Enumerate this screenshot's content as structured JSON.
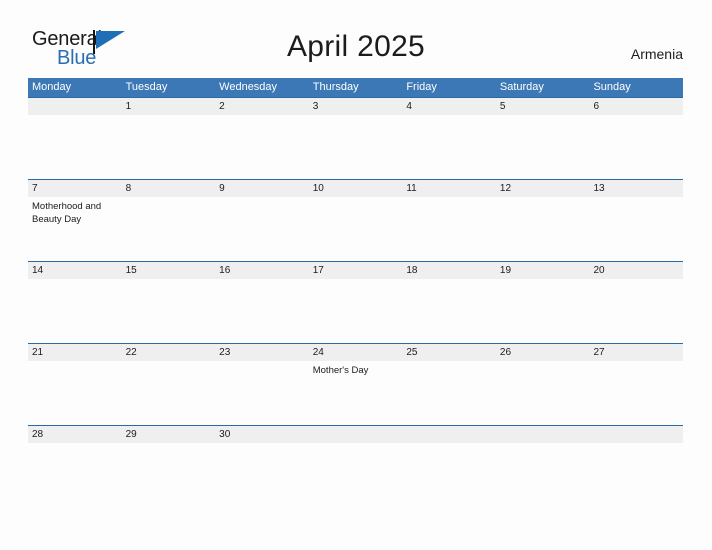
{
  "branding": {
    "logo_text_1": "General",
    "logo_text_2": "Blue",
    "logo_icon": "flag-triangle-icon"
  },
  "header": {
    "title": "April 2025",
    "location": "Armenia"
  },
  "colors": {
    "header_blue": "#3b78b5",
    "divider_blue": "#2a6aa5",
    "band_gray": "#efefef",
    "logo_blue": "#2a6db3",
    "page_background": "#fdfdfd",
    "text": "#1c1c1c"
  },
  "calendar": {
    "month": "April",
    "year": "2025",
    "weekday_headers": [
      "Monday",
      "Tuesday",
      "Wednesday",
      "Thursday",
      "Friday",
      "Saturday",
      "Sunday"
    ],
    "weeks": [
      {
        "days": [
          {
            "num": "",
            "event": ""
          },
          {
            "num": "1",
            "event": ""
          },
          {
            "num": "2",
            "event": ""
          },
          {
            "num": "3",
            "event": ""
          },
          {
            "num": "4",
            "event": ""
          },
          {
            "num": "5",
            "event": ""
          },
          {
            "num": "6",
            "event": ""
          }
        ]
      },
      {
        "days": [
          {
            "num": "7",
            "event": "Motherhood and Beauty Day"
          },
          {
            "num": "8",
            "event": ""
          },
          {
            "num": "9",
            "event": ""
          },
          {
            "num": "10",
            "event": ""
          },
          {
            "num": "11",
            "event": ""
          },
          {
            "num": "12",
            "event": ""
          },
          {
            "num": "13",
            "event": ""
          }
        ]
      },
      {
        "days": [
          {
            "num": "14",
            "event": ""
          },
          {
            "num": "15",
            "event": ""
          },
          {
            "num": "16",
            "event": ""
          },
          {
            "num": "17",
            "event": ""
          },
          {
            "num": "18",
            "event": ""
          },
          {
            "num": "19",
            "event": ""
          },
          {
            "num": "20",
            "event": ""
          }
        ]
      },
      {
        "days": [
          {
            "num": "21",
            "event": ""
          },
          {
            "num": "22",
            "event": ""
          },
          {
            "num": "23",
            "event": ""
          },
          {
            "num": "24",
            "event": "Mother's Day"
          },
          {
            "num": "25",
            "event": ""
          },
          {
            "num": "26",
            "event": ""
          },
          {
            "num": "27",
            "event": ""
          }
        ]
      },
      {
        "days": [
          {
            "num": "28",
            "event": ""
          },
          {
            "num": "29",
            "event": ""
          },
          {
            "num": "30",
            "event": ""
          },
          {
            "num": "",
            "event": ""
          },
          {
            "num": "",
            "event": ""
          },
          {
            "num": "",
            "event": ""
          },
          {
            "num": "",
            "event": ""
          }
        ]
      }
    ]
  }
}
